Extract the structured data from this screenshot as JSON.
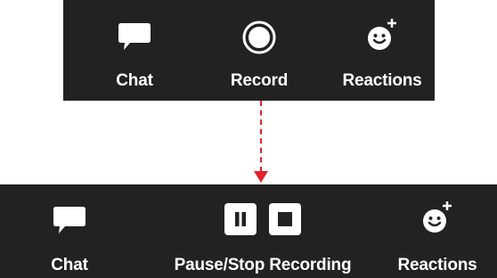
{
  "top_toolbar": {
    "chat_label": "Chat",
    "record_label": "Record",
    "reactions_label": "Reactions",
    "icons": {
      "chat": "chat-bubble-icon",
      "record": "record-circle-icon",
      "reactions": "smiley-plus-icon"
    }
  },
  "bottom_toolbar": {
    "chat_label": "Chat",
    "recording_label": "Pause/Stop Recording",
    "reactions_label": "Reactions",
    "icons": {
      "chat": "chat-bubble-icon",
      "pause": "pause-icon",
      "stop": "stop-icon",
      "reactions": "smiley-plus-icon"
    }
  },
  "colors": {
    "toolbar_bg": "#222222",
    "icon": "#ffffff",
    "arrow": "#e0242a"
  }
}
